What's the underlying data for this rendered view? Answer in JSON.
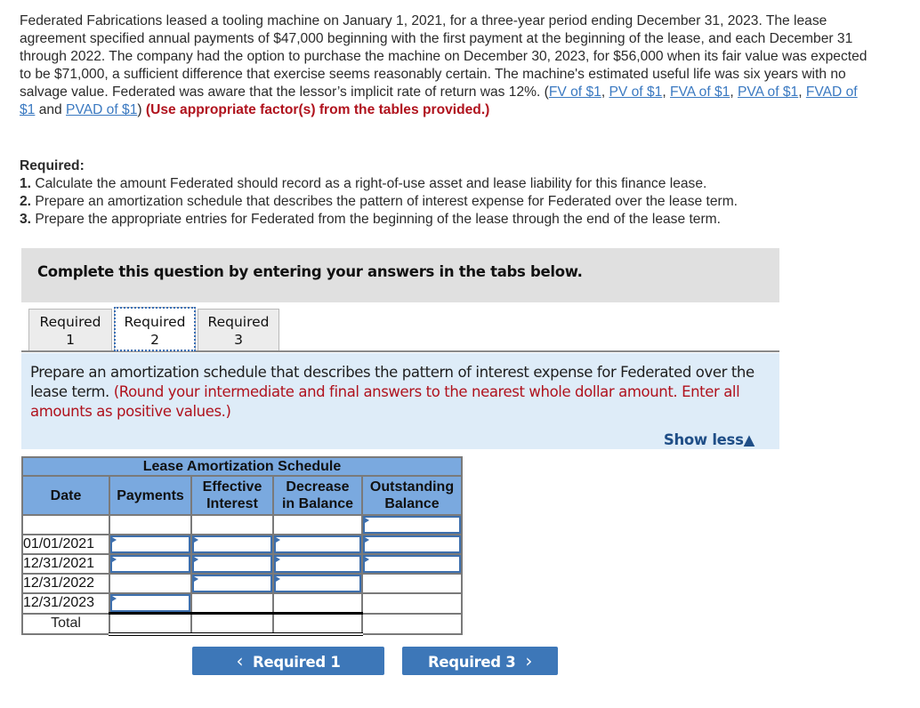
{
  "problem": {
    "text_before_links": "Federated Fabrications leased a tooling machine on January 1, 2021, for a three-year period ending December 31, 2023. The lease agreement specified annual payments of $47,000 beginning with the first payment at the beginning of the lease, and each December 31 through 2022. The company had the option to purchase the machine on December 30, 2023, for $56,000 when its fair value was expected to be $71,000, a sufficient difference that exercise seems reasonably certain. The machine's estimated useful life was six years with no salvage value. Federated was aware that the lessor’s implicit rate of return was 12%. (",
    "links": [
      "FV of $1",
      "PV of $1",
      "FVA of $1",
      "PVA of $1",
      "FVAD of $1",
      "PVAD of $1"
    ],
    "sep_comma": ", ",
    "sep_and": " and ",
    "close_paren": ") ",
    "red_note": "(Use appropriate factor(s) from the tables provided.)"
  },
  "required": {
    "heading": "Required:",
    "items": [
      {
        "num": "1.",
        "text": " Calculate the amount Federated should record as a right-of-use asset and lease liability for this finance lease."
      },
      {
        "num": "2.",
        "text": " Prepare an amortization schedule that describes the pattern of interest expense for Federated over the lease term."
      },
      {
        "num": "3.",
        "text": " Prepare the appropriate entries for Federated from the beginning of the lease through the end of the lease term."
      }
    ]
  },
  "complete_box": "Complete this question by entering your answers in the tabs below.",
  "tabs": [
    {
      "line1": "Required",
      "line2": "1",
      "active": false
    },
    {
      "line1": "Required",
      "line2": "2",
      "active": true
    },
    {
      "line1": "Required",
      "line2": "3",
      "active": false
    }
  ],
  "instructions": {
    "text": "Prepare an amortization schedule that describes the pattern of interest expense for Federated over the lease term. ",
    "red_text": "(Round your intermediate and final answers to the nearest whole dollar amount. Enter all amounts as positive values.)",
    "show_less": "Show less",
    "show_less_icon": "▲"
  },
  "schedule": {
    "title": "Lease Amortization Schedule",
    "columns": [
      "Date",
      "Payments",
      "Effective Interest",
      "Decrease in Balance",
      "Outstanding Balance"
    ],
    "column_lines": [
      [
        "Date"
      ],
      [
        "Payments"
      ],
      [
        "Effective",
        "Interest"
      ],
      [
        "Decrease",
        "in Balance"
      ],
      [
        "Outstanding",
        "Balance"
      ]
    ],
    "rows": [
      {
        "date": "",
        "payments": "",
        "interest": "",
        "decrease": "",
        "balance": ""
      },
      {
        "date": "01/01/2021",
        "payments": "",
        "interest": "",
        "decrease": "",
        "balance": ""
      },
      {
        "date": "12/31/2021",
        "payments": "",
        "interest": "",
        "decrease": "",
        "balance": ""
      },
      {
        "date": "12/31/2022",
        "payments": "",
        "interest": "",
        "decrease": "",
        "balance": ""
      },
      {
        "date": "12/31/2023",
        "payments": "",
        "interest": "",
        "decrease": "",
        "balance": ""
      }
    ],
    "total_label": "Total"
  },
  "nav": {
    "prev_label": "Required 1",
    "prev_icon": "‹",
    "next_label": "Required 3",
    "next_icon": "›"
  }
}
